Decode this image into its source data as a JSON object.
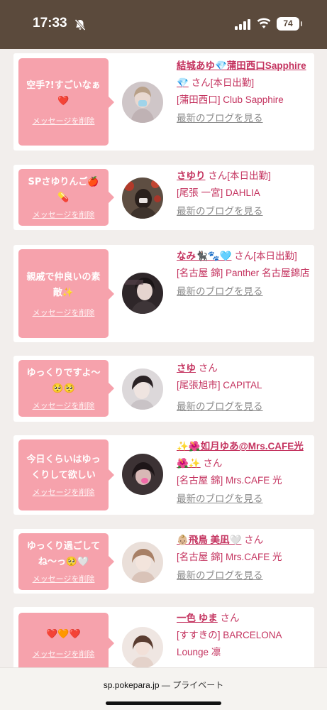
{
  "status": {
    "time": "17:33",
    "battery": "74",
    "bell_icon": "bell-slash-icon"
  },
  "browser": {
    "domain": "sp.pokepara.jp",
    "separator": "—",
    "mode": "プライベート"
  },
  "common": {
    "delete_label": "メッセージを削除",
    "san": "さん",
    "blog_label": "最新のブログを見る"
  },
  "cards": [
    {
      "message": "空手?!すごいなぁ❤️",
      "name": "結城あゆ💎蒲田西口Sapphire💎",
      "status": "[本日出勤]",
      "shop": "[蒲田西口] Club Sapphire",
      "avatar_color": "#c8c0c4"
    },
    {
      "message": "SPさゆりんご🍎💊",
      "name": "さゆり",
      "status": "[本日出勤]",
      "shop": "[尾張 一宮] DAHLIA",
      "avatar_color": "#6a5a4e"
    },
    {
      "message": "親戚で仲良いの素敵✨",
      "name": "なみ🐈‍⬛🐾🩵",
      "status": "[本日出勤]",
      "shop": "[名古屋 錦] Panther 名古屋錦店",
      "avatar_color": "#3a3236"
    },
    {
      "message": "ゆっくりですよ〜🥺🥺",
      "name": "さゆ",
      "status": "",
      "shop": "[尾張旭市] CAPITAL",
      "avatar_color": "#d6d2d4"
    },
    {
      "message": "今日くらいはゆっくりして欲しい",
      "name": "✨🌺如月ゆあ@Mrs.CAFE光🌺✨",
      "status": "",
      "shop": "[名古屋 錦] Mrs.CAFE 光",
      "avatar_color": "#4a3e42"
    },
    {
      "message": "ゆっくり過ごしてね〜っ🥺🤍",
      "name": "👶🏼飛鳥 美凪🤍",
      "status": "",
      "shop": "[名古屋 錦] Mrs.CAFE 光",
      "avatar_color": "#e2cdc4"
    },
    {
      "message": "❤️🧡❤️",
      "name": "一色 ゆま",
      "status": "",
      "shop": "[すすきの] BARCELONA Lounge 凛",
      "avatar_color": "#e8dcd6"
    }
  ]
}
